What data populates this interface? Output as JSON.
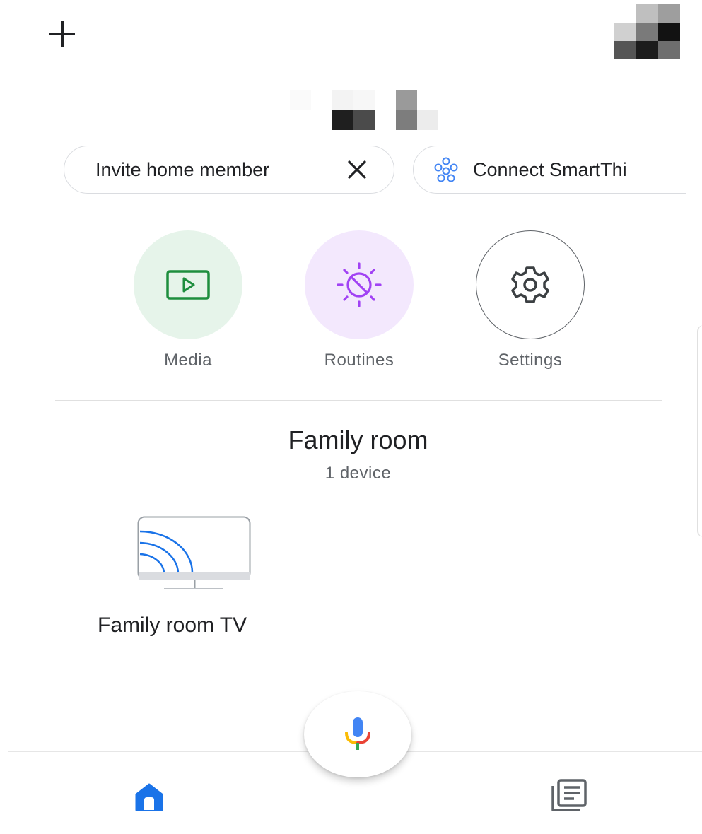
{
  "header": {
    "add_icon": "plus-icon",
    "avatar_icon": "account-avatar"
  },
  "chips": {
    "invite": {
      "label": "Invite home member",
      "close_icon": "close-icon"
    },
    "connect": {
      "label": "Connect SmartThi",
      "icon": "smartthings-icon"
    }
  },
  "shortcuts": [
    {
      "label": "Media",
      "icon": "media-play-icon",
      "bg": "#e6f4ea",
      "accent": "#1e8e3e"
    },
    {
      "label": "Routines",
      "icon": "routines-sun-icon",
      "bg": "#f3e8fd",
      "accent": "#a142f4"
    },
    {
      "label": "Settings",
      "icon": "gear-icon",
      "bg": "#ffffff",
      "accent": "#3c4043"
    }
  ],
  "room": {
    "title": "Family room",
    "subtitle": "1 device",
    "devices": [
      {
        "label": "Family room TV",
        "icon": "cast-tv-icon"
      }
    ]
  },
  "bottom_nav": {
    "home_icon": "home-icon",
    "mic_icon": "assistant-mic-icon",
    "feed_icon": "feed-icon",
    "accent": "#1a73e8"
  }
}
